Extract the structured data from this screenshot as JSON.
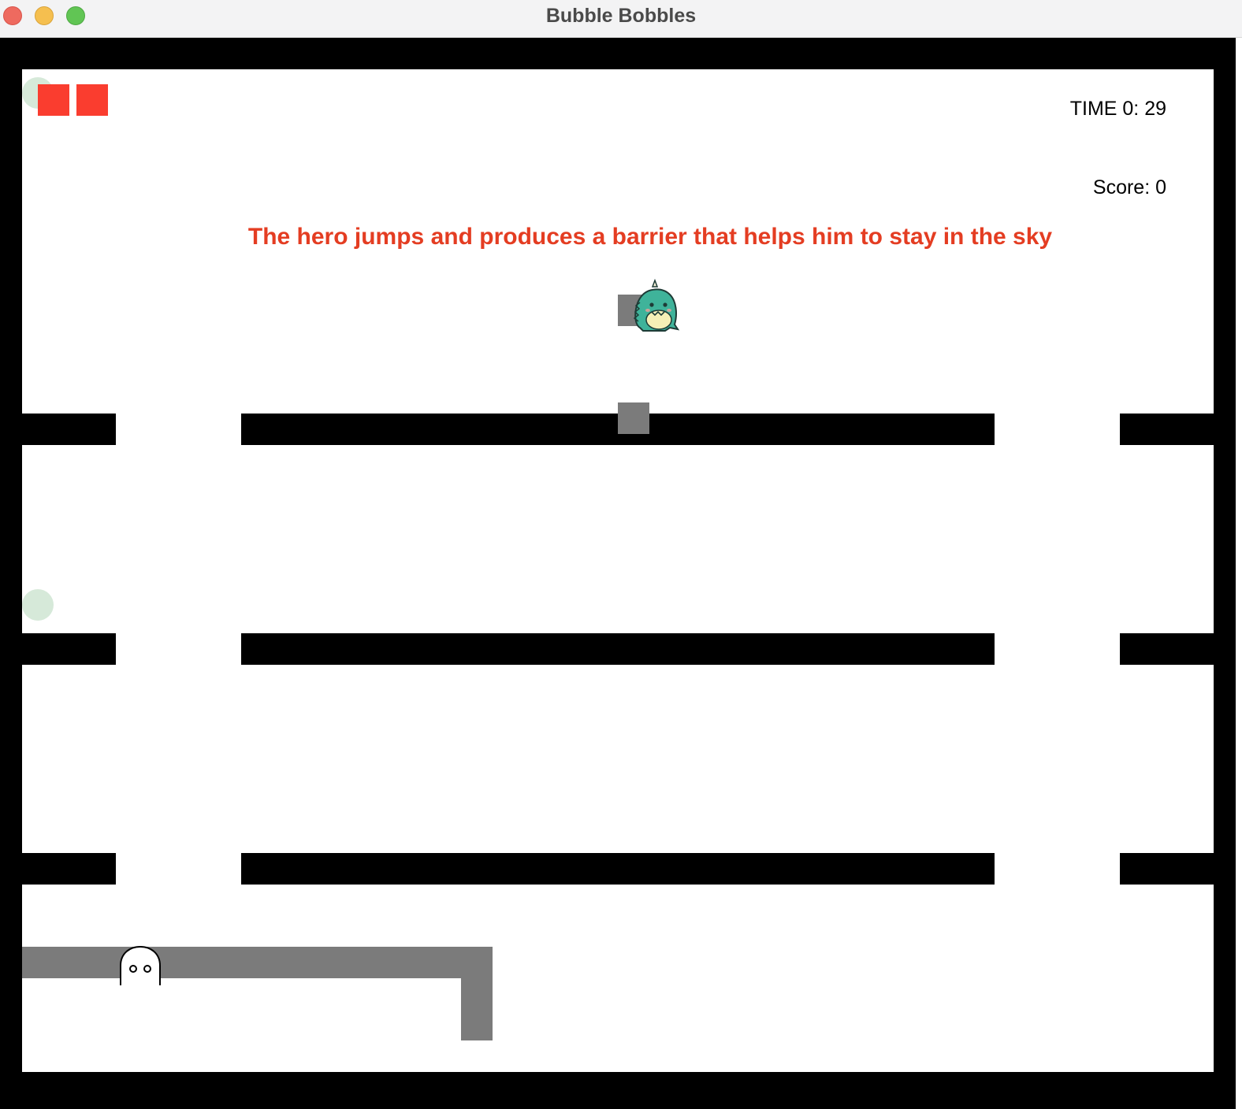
{
  "window": {
    "title": "Bubble Bobbles"
  },
  "hud": {
    "time": "TIME 0: 29",
    "score": "Score: 0"
  },
  "caption": "The hero jumps and produces a barrier that helps him to stay in the sky",
  "lives": {
    "count": 2
  },
  "colors": {
    "wall": "#000000",
    "barrier": "#7b7b7b",
    "life": "#fa3d2f",
    "caption": "#e43d22",
    "bubble": "#b4d7b9"
  },
  "sprites": {
    "hero": "dinosaur-hero-icon",
    "enemy": "ghost-enemy-icon"
  }
}
